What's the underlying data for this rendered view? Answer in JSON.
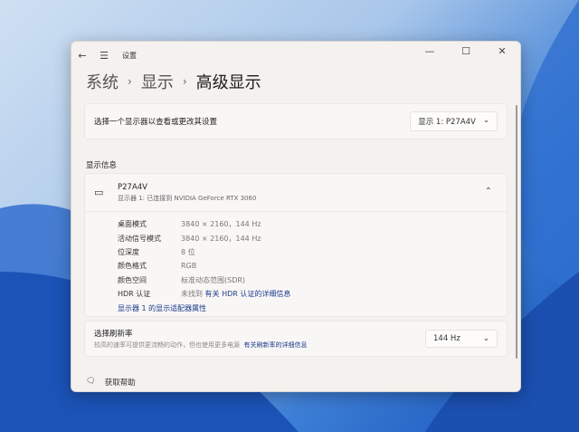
{
  "window": {
    "title": "设置",
    "minimize": "—",
    "maximize": "☐",
    "close": "✕"
  },
  "breadcrumb": [
    "系统",
    "显示",
    "高级显示"
  ],
  "select_display": {
    "label": "选择一个显示器以查看或更改其设置",
    "value": "显示 1: P27A4V"
  },
  "section_title": "显示信息",
  "display": {
    "name": "P27A4V",
    "subtitle": "显示器 1: 已连接到 NVIDIA GeForce RTX 3060",
    "rows": [
      {
        "k": "桌面模式",
        "v": "3840 × 2160，144 Hz"
      },
      {
        "k": "活动信号模式",
        "v": "3840 × 2160，144 Hz"
      },
      {
        "k": "位深度",
        "v": "8 位"
      },
      {
        "k": "颜色格式",
        "v": "RGB"
      },
      {
        "k": "颜色空间",
        "v": "标准动态范围(SDR)"
      },
      {
        "k": "HDR 认证",
        "v": "未找到",
        "link": "有关 HDR 认证的详细信息"
      }
    ],
    "adapter_link": "显示器 1 的显示适配器属性"
  },
  "refresh": {
    "title": "选择刷新率",
    "desc": "较高的速率可提供更流畅的动作，但也使用更多电源",
    "link": "有关刷新率的详细信息",
    "value": "144 Hz"
  },
  "help": "获取帮助"
}
